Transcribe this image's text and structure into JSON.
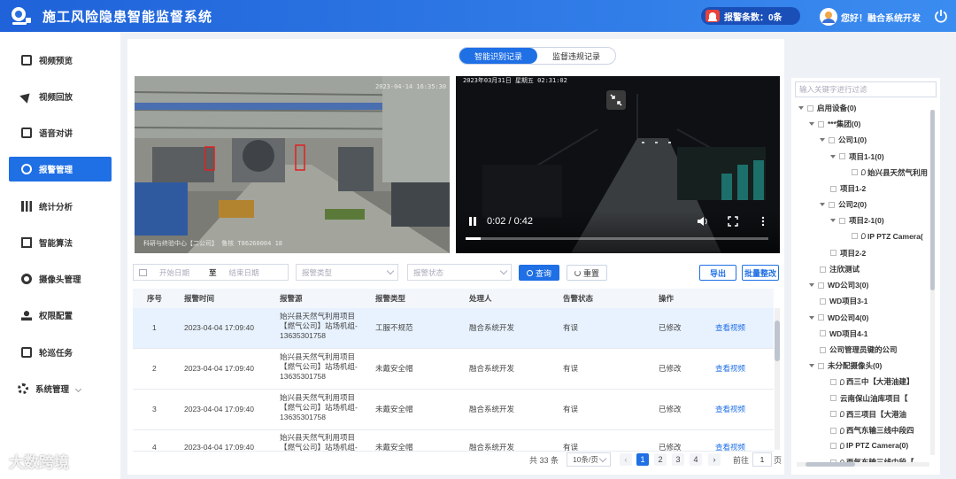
{
  "app": {
    "title": "施工风险隐患智能监督系统"
  },
  "header": {
    "alarm_label": "报警条数：0条",
    "greeting": "您好！融合系统开发"
  },
  "sidebar": {
    "items": [
      {
        "label": "视频预览"
      },
      {
        "label": "视频回放"
      },
      {
        "label": "语音对讲"
      },
      {
        "label": "报警管理",
        "active": true
      },
      {
        "label": "统计分析"
      },
      {
        "label": "智能算法"
      },
      {
        "label": "摄像头管理"
      },
      {
        "label": "权限配置"
      },
      {
        "label": "轮巡任务"
      },
      {
        "label": "系统管理"
      }
    ]
  },
  "tabs": [
    {
      "label": "智能识别记录",
      "active": true
    },
    {
      "label": "监督违规记录",
      "active": false
    }
  ],
  "video_left": {
    "timestamp": "2023-04-14 16:35:30",
    "caption": "科研与终验中心【二公司】 鲁核 T86260004 18"
  },
  "video_right": {
    "timestamp": "2023年03月31日 星期五 02:31:02",
    "time": "0:02 / 0:42",
    "progress": 0.05
  },
  "filters": {
    "start_placeholder": "开始日期",
    "to": "至",
    "end_placeholder": "结束日期",
    "type_placeholder": "报警类型",
    "status_placeholder": "报警状态",
    "query": "查询",
    "reset": "重置",
    "export": "导出",
    "batch": "批量整改"
  },
  "table": {
    "headers": [
      "序号",
      "报警时间",
      "报警源",
      "报警类型",
      "处理人",
      "告警状态",
      "操作"
    ],
    "rows": [
      {
        "no": "1",
        "time": "2023-04-04 17:09:40",
        "src1": "始兴县天然气利用项目",
        "src2": "【燃气公司】站场机组-",
        "src3": "13635301758",
        "type": "工服不规范",
        "handler": "融合系统开发",
        "status": "有误",
        "op": "已修改",
        "link": "查看视频"
      },
      {
        "no": "2",
        "time": "2023-04-04 17:09:40",
        "src1": "始兴县天然气利用项目",
        "src2": "【燃气公司】站场机组-",
        "src3": "13635301758",
        "type": "未戴安全帽",
        "handler": "融合系统开发",
        "status": "有误",
        "op": "已修改",
        "link": "查看视频"
      },
      {
        "no": "3",
        "time": "2023-04-04 17:09:40",
        "src1": "始兴县天然气利用项目",
        "src2": "【燃气公司】站场机组-",
        "src3": "13635301758",
        "type": "未戴安全帽",
        "handler": "融合系统开发",
        "status": "有误",
        "op": "已修改",
        "link": "查看视频"
      },
      {
        "no": "4",
        "time": "2023-04-04 17:09:40",
        "src1": "始兴县天然气利用项目",
        "src2": "【燃气公司】站场机组-",
        "src3": "",
        "type": "未戴安全帽",
        "handler": "融合系统开发",
        "status": "有误",
        "op": "已修改",
        "link": "查看视频"
      }
    ]
  },
  "pagination": {
    "total": "共 33 条",
    "size": "10条/页",
    "pages": [
      "1",
      "2",
      "3",
      "4"
    ],
    "goto": "前往",
    "goto_value": "1",
    "unit": "页"
  },
  "tree": {
    "search_placeholder": "输入关键字进行过滤",
    "nodes": [
      "启用设备(0)",
      "***集团(0)",
      "公司1(0)",
      "项目1-1(0)",
      "始兴县天然气利用",
      "项目1-2",
      "公司2(0)",
      "项目2-1(0)",
      "IP PTZ Camera(",
      "项目2-2",
      "注欣测试",
      "WD公司3(0)",
      "WD项目3-1",
      "WD公司4(0)",
      "WD项目4-1",
      "公司管理员键的公司",
      "未分配摄像头(0)",
      "西三中【大港油建】",
      "云南保山油库项目【",
      "西三项目【大港油",
      "西气东输三线中段四",
      "IP PTZ Camera(0)",
      "西气东输三线中段【"
    ]
  },
  "watermark": "大数跨境",
  "colors": {
    "primary": "#1f6fe5",
    "header_start": "#1f62d9",
    "header_end": "#3b8cf0"
  }
}
